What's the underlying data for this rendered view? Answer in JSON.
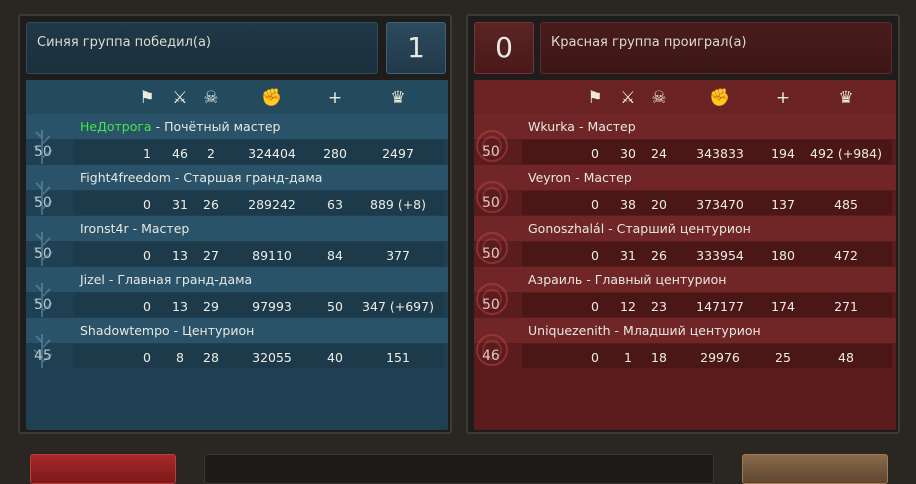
{
  "blue": {
    "title": "Синяя группа победил(а)",
    "score": "1",
    "headers": [
      "flag-icon",
      "crossed-swords-icon",
      "skull-icon",
      "fist-icon",
      "plus-icon",
      "crown-icon"
    ],
    "players": [
      {
        "level": "50",
        "name": "НеДотрога",
        "sep": " - ",
        "rank": "Почётный мастер",
        "flags": "1",
        "kills": "46",
        "deaths": "2",
        "damage": "324404",
        "heal": "280",
        "score": "2497",
        "highlight": true
      },
      {
        "level": "50",
        "name": "Fight4freedom",
        "sep": " - ",
        "rank": "Старшая гранд-дама",
        "flags": "0",
        "kills": "31",
        "deaths": "26",
        "damage": "289242",
        "heal": "63",
        "score": "889 (+8)",
        "highlight": false
      },
      {
        "level": "50",
        "name": "Ironst4r",
        "sep": " - ",
        "rank": "Мастер",
        "flags": "0",
        "kills": "13",
        "deaths": "27",
        "damage": "89110",
        "heal": "84",
        "score": "377",
        "highlight": false
      },
      {
        "level": "50",
        "name": "Jizel",
        "sep": " - ",
        "rank": "Главная гранд-дама",
        "flags": "0",
        "kills": "13",
        "deaths": "29",
        "damage": "97993",
        "heal": "50",
        "score": "347 (+697)",
        "highlight": false
      },
      {
        "level": "45",
        "name": "Shadowtempo",
        "sep": " - ",
        "rank": "Центурион",
        "flags": "0",
        "kills": "8",
        "deaths": "28",
        "damage": "32055",
        "heal": "40",
        "score": "151",
        "highlight": false
      }
    ]
  },
  "red": {
    "title": "Красная группа проиграл(а)",
    "score": "0",
    "players": [
      {
        "level": "50",
        "name": "Wkurka",
        "sep": " - ",
        "rank": "Мастер",
        "flags": "0",
        "kills": "30",
        "deaths": "24",
        "damage": "343833",
        "heal": "194",
        "score": "492 (+984)"
      },
      {
        "level": "50",
        "name": "Veyron",
        "sep": " - ",
        "rank": "Мастер",
        "flags": "0",
        "kills": "38",
        "deaths": "20",
        "damage": "373470",
        "heal": "137",
        "score": "485"
      },
      {
        "level": "50",
        "name": "Gonoszhalál",
        "sep": " - ",
        "rank": "Старший центурион",
        "flags": "0",
        "kills": "31",
        "deaths": "26",
        "damage": "333954",
        "heal": "180",
        "score": "472"
      },
      {
        "level": "50",
        "name": "Азраиль",
        "sep": " - ",
        "rank": "Главный центурион",
        "flags": "0",
        "kills": "12",
        "deaths": "23",
        "damage": "147177",
        "heal": "174",
        "score": "271"
      },
      {
        "level": "46",
        "name": "Uniquezenith",
        "sep": " - ",
        "rank": "Младший центурион",
        "flags": "0",
        "kills": "1",
        "deaths": "18",
        "damage": "29976",
        "heal": "25",
        "score": "48"
      }
    ]
  },
  "colors": {
    "highlight_name": "#46e646",
    "blue_panel": "#1f4052",
    "red_panel": "#5a1c1c"
  }
}
